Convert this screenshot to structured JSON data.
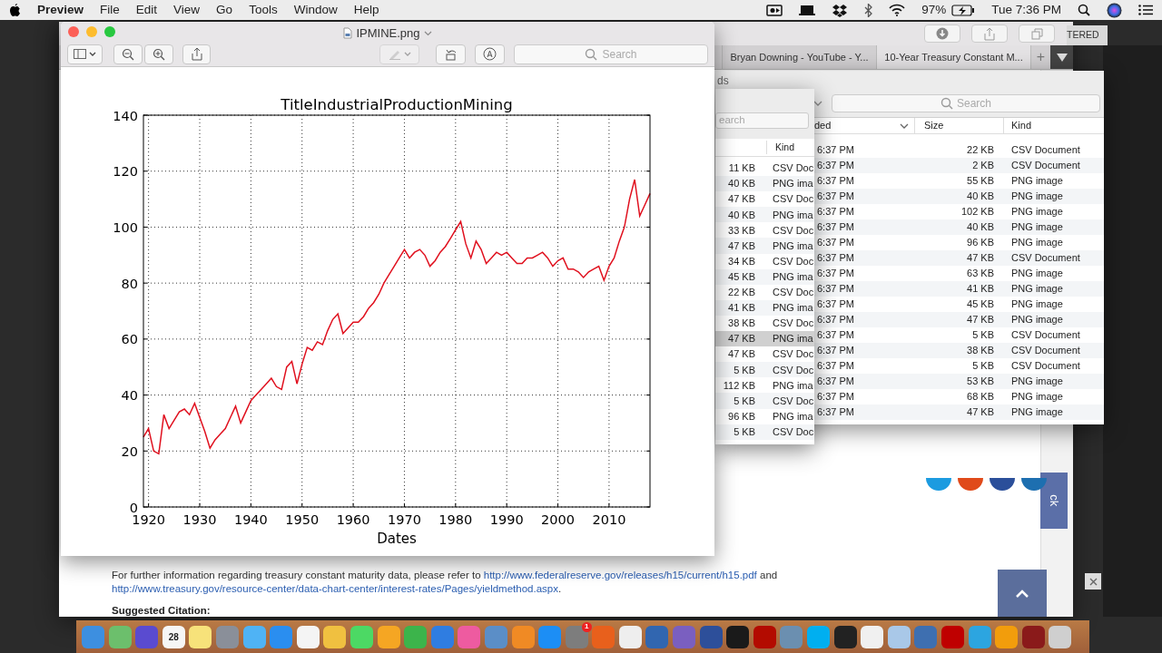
{
  "menu_bar": {
    "app": "Preview",
    "menus": [
      "File",
      "Edit",
      "View",
      "Go",
      "Tools",
      "Window",
      "Help"
    ],
    "battery": "97%",
    "clock": "Tue 7:36 PM"
  },
  "browser": {
    "tabs": [
      {
        "label": "Bryan Downing - YouTube - Y...",
        "selected": false
      },
      {
        "label": "10-Year Treasury Constant M...",
        "selected": true
      }
    ],
    "new_tab": "+",
    "paragraph": {
      "before": "For further information regarding treasury constant maturity data, please refer to ",
      "link_1": "http://www.federalreserve.gov/releases/h15/current/h15.pdf",
      "middle": " and ",
      "link_2": "http://www.treasury.gov/resource-center/data-chart-center/interest-rates/Pages/yieldmethod.aspx",
      "after": "."
    },
    "citation_heading": "Suggested Citation:",
    "feedback_tab": "ck"
  },
  "side_window": {
    "title": "TERED"
  },
  "downloads_window": {
    "title": "ds",
    "search_placeholder": "Search",
    "columns": [
      "ded",
      "Size",
      "Kind"
    ],
    "rows": [
      {
        "date": "6:37 PM",
        "size": "22 KB",
        "kind": "CSV Document"
      },
      {
        "date": "6:37 PM",
        "size": "2 KB",
        "kind": "CSV Document"
      },
      {
        "date": "6:37 PM",
        "size": "55 KB",
        "kind": "PNG image"
      },
      {
        "date": "6:37 PM",
        "size": "40 KB",
        "kind": "PNG image"
      },
      {
        "date": "6:37 PM",
        "size": "102 KB",
        "kind": "PNG image"
      },
      {
        "date": "6:37 PM",
        "size": "40 KB",
        "kind": "PNG image"
      },
      {
        "date": "6:37 PM",
        "size": "96 KB",
        "kind": "PNG image"
      },
      {
        "date": "6:37 PM",
        "size": "47 KB",
        "kind": "CSV Document"
      },
      {
        "date": "6:37 PM",
        "size": "63 KB",
        "kind": "PNG image"
      },
      {
        "date": "6:37 PM",
        "size": "41 KB",
        "kind": "PNG image"
      },
      {
        "date": "6:37 PM",
        "size": "45 KB",
        "kind": "PNG image"
      },
      {
        "date": "6:37 PM",
        "size": "47 KB",
        "kind": "PNG image"
      },
      {
        "date": "6:37 PM",
        "size": "5 KB",
        "kind": "CSV Document"
      },
      {
        "date": "6:37 PM",
        "size": "38 KB",
        "kind": "CSV Document"
      },
      {
        "date": "6:37 PM",
        "size": "5 KB",
        "kind": "CSV Document"
      },
      {
        "date": "6:37 PM",
        "size": "53 KB",
        "kind": "PNG image"
      },
      {
        "date": "6:37 PM",
        "size": "68 KB",
        "kind": "PNG image"
      },
      {
        "date": "6:37 PM",
        "size": "47 KB",
        "kind": "PNG image"
      }
    ]
  },
  "finder_window": {
    "search_placeholder": "earch",
    "column": "Kind",
    "rows": [
      {
        "size": "11 KB",
        "kind": "CSV Doc",
        "selected": false
      },
      {
        "size": "40 KB",
        "kind": "PNG ima",
        "selected": false
      },
      {
        "size": "47 KB",
        "kind": "CSV Doc",
        "selected": false
      },
      {
        "size": "40 KB",
        "kind": "PNG ima",
        "selected": false
      },
      {
        "size": "33 KB",
        "kind": "CSV Doc",
        "selected": false
      },
      {
        "size": "47 KB",
        "kind": "PNG ima",
        "selected": false
      },
      {
        "size": "34 KB",
        "kind": "CSV Doc",
        "selected": false
      },
      {
        "size": "45 KB",
        "kind": "PNG ima",
        "selected": false
      },
      {
        "size": "22 KB",
        "kind": "CSV Doc",
        "selected": false
      },
      {
        "size": "41 KB",
        "kind": "PNG ima",
        "selected": false
      },
      {
        "size": "38 KB",
        "kind": "CSV Doc",
        "selected": false
      },
      {
        "size": "47 KB",
        "kind": "PNG ima",
        "selected": true
      },
      {
        "size": "47 KB",
        "kind": "CSV Doc",
        "selected": false
      },
      {
        "size": "5 KB",
        "kind": "CSV Doc",
        "selected": false
      },
      {
        "size": "112 KB",
        "kind": "PNG ima",
        "selected": false
      },
      {
        "size": "5 KB",
        "kind": "CSV Doc",
        "selected": false
      },
      {
        "size": "96 KB",
        "kind": "PNG ima",
        "selected": false
      },
      {
        "size": "5 KB",
        "kind": "CSV Doc",
        "selected": false
      }
    ]
  },
  "preview_window": {
    "title": "IPMINE.png",
    "search_placeholder": "Search",
    "chart_data": {
      "type": "line",
      "title": "TitleIndustrialProductionMining",
      "xlabel": "Dates",
      "xlim": [
        1919,
        2018
      ],
      "ylim": [
        0,
        140
      ],
      "xticks": [
        1920,
        1930,
        1940,
        1950,
        1960,
        1970,
        1980,
        1990,
        2000,
        2010
      ],
      "yticks": [
        0,
        20,
        40,
        60,
        80,
        100,
        120,
        140
      ],
      "x": [
        1919,
        1920,
        1921,
        1922,
        1923,
        1924,
        1925,
        1926,
        1927,
        1928,
        1929,
        1930,
        1931,
        1932,
        1933,
        1934,
        1935,
        1936,
        1937,
        1938,
        1939,
        1940,
        1941,
        1942,
        1943,
        1944,
        1945,
        1946,
        1947,
        1948,
        1949,
        1950,
        1951,
        1952,
        1953,
        1954,
        1955,
        1956,
        1957,
        1958,
        1959,
        1960,
        1961,
        1962,
        1963,
        1964,
        1965,
        1966,
        1967,
        1968,
        1969,
        1970,
        1971,
        1972,
        1973,
        1974,
        1975,
        1976,
        1977,
        1978,
        1979,
        1980,
        1981,
        1982,
        1983,
        1984,
        1985,
        1986,
        1987,
        1988,
        1989,
        1990,
        1991,
        1992,
        1993,
        1994,
        1995,
        1996,
        1997,
        1998,
        1999,
        2000,
        2001,
        2002,
        2003,
        2004,
        2005,
        2006,
        2007,
        2008,
        2009,
        2010,
        2011,
        2012,
        2013,
        2014,
        2015,
        2016,
        2017,
        2018
      ],
      "grid": true,
      "series": [
        {
          "color": "#e0101e",
          "values": [
            25,
            28,
            20,
            19,
            33,
            28,
            31,
            34,
            35,
            33,
            37,
            32,
            27,
            21,
            24,
            26,
            28,
            32,
            36,
            30,
            34,
            38,
            40,
            42,
            44,
            46,
            43,
            42,
            50,
            52,
            44,
            51,
            57,
            56,
            59,
            58,
            63,
            67,
            69,
            62,
            64,
            66,
            66,
            68,
            71,
            73,
            76,
            80,
            83,
            86,
            89,
            92,
            89,
            91,
            92,
            90,
            86,
            88,
            91,
            93,
            96,
            99,
            102,
            94,
            89,
            95,
            92,
            87,
            89,
            91,
            90,
            91,
            89,
            87,
            87,
            89,
            89,
            90,
            91,
            89,
            86,
            88,
            89,
            85,
            85,
            84,
            82,
            84,
            85,
            86,
            81,
            86,
            89,
            95,
            100,
            110,
            117,
            104,
            108,
            112
          ]
        }
      ]
    }
  },
  "dock": [
    {
      "color": "#3d8fe0"
    },
    {
      "color": "#6cbf6c"
    },
    {
      "color": "#5a4bd0"
    },
    {
      "color": "#f6f6f6",
      "text": "28"
    },
    {
      "color": "#f7e27a"
    },
    {
      "color": "#8a8f99"
    },
    {
      "color": "#4fb3f5"
    },
    {
      "color": "#2a8ef0"
    },
    {
      "color": "#f4f4f4"
    },
    {
      "color": "#f0c040"
    },
    {
      "color": "#4cd964"
    },
    {
      "color": "#f5a623"
    },
    {
      "color": "#3cb44b"
    },
    {
      "color": "#2f7de1"
    },
    {
      "color": "#ee5ba0"
    },
    {
      "color": "#5b8ec7"
    },
    {
      "color": "#f08a24"
    },
    {
      "color": "#1c8ef5"
    },
    {
      "color": "#7d7d7d",
      "badge": "1"
    },
    {
      "color": "#e8601c"
    },
    {
      "color": "#eeeeee"
    },
    {
      "color": "#3166b0"
    },
    {
      "color": "#7a5fc0"
    },
    {
      "color": "#2d4f9a"
    },
    {
      "color": "#1a1a1a"
    },
    {
      "color": "#b30b00"
    },
    {
      "color": "#6b8fb0"
    },
    {
      "color": "#00aff0"
    },
    {
      "color": "#222222"
    },
    {
      "color": "#f0f0f0"
    },
    {
      "color": "#a9c8e8"
    },
    {
      "color": "#3e6fb0"
    },
    {
      "color": "#bf0000"
    },
    {
      "color": "#2ca5e0"
    },
    {
      "color": "#f29d0c"
    },
    {
      "color": "#8a1a1a"
    },
    {
      "color": "#cfcfcf"
    }
  ]
}
